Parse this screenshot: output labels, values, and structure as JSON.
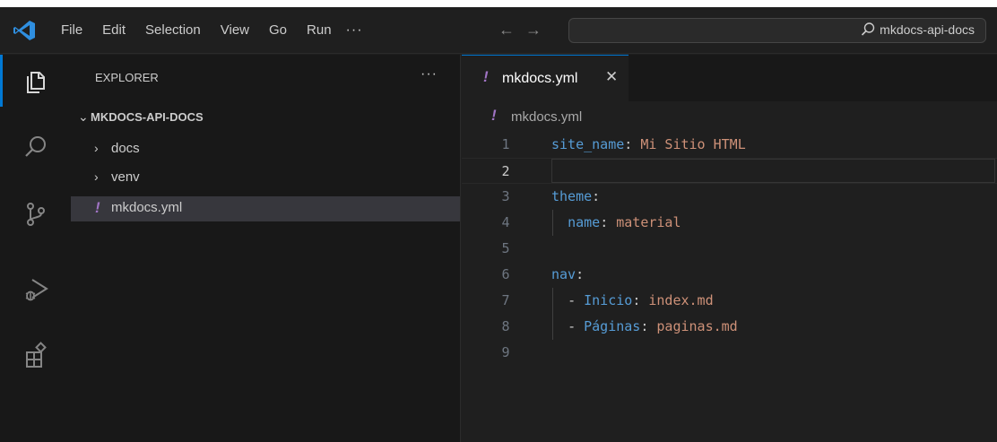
{
  "menu": {
    "items": [
      "File",
      "Edit",
      "Selection",
      "View",
      "Go",
      "Run"
    ],
    "more": "···"
  },
  "nav": {
    "back": "←",
    "forward": "→"
  },
  "search": {
    "text": "mkdocs-api-docs"
  },
  "explorer": {
    "title": "EXPLORER",
    "more": "···",
    "root": "MKDOCS-API-DOCS",
    "items": [
      {
        "label": "docs",
        "type": "folder"
      },
      {
        "label": "venv",
        "type": "folder"
      },
      {
        "label": "mkdocs.yml",
        "type": "file",
        "selected": true
      }
    ]
  },
  "editor": {
    "tab": {
      "label": "mkdocs.yml",
      "close": "✕"
    },
    "breadcrumb": "mkdocs.yml",
    "yaml_glyph": "!",
    "current_line": 2,
    "lines": [
      {
        "n": "1",
        "key": "site_name",
        "colon": ":",
        "value": " Mi Sitio HTML"
      },
      {
        "n": "2"
      },
      {
        "n": "3",
        "key": "theme",
        "colon": ":"
      },
      {
        "n": "4",
        "key": "name",
        "colon": ":",
        "value": " material"
      },
      {
        "n": "5"
      },
      {
        "n": "6",
        "key": "nav",
        "colon": ":"
      },
      {
        "n": "7",
        "dash": "- ",
        "key": "Inicio",
        "colon": ":",
        "value": " index.md"
      },
      {
        "n": "8",
        "dash": "- ",
        "key": "Páginas",
        "colon": ":",
        "value": " paginas.md"
      },
      {
        "n": "9"
      }
    ]
  },
  "colors": {
    "accent": "#0078d4",
    "yaml_key": "#569cd6",
    "yaml_string": "#ce9178",
    "yaml_icon": "#a074c4"
  }
}
